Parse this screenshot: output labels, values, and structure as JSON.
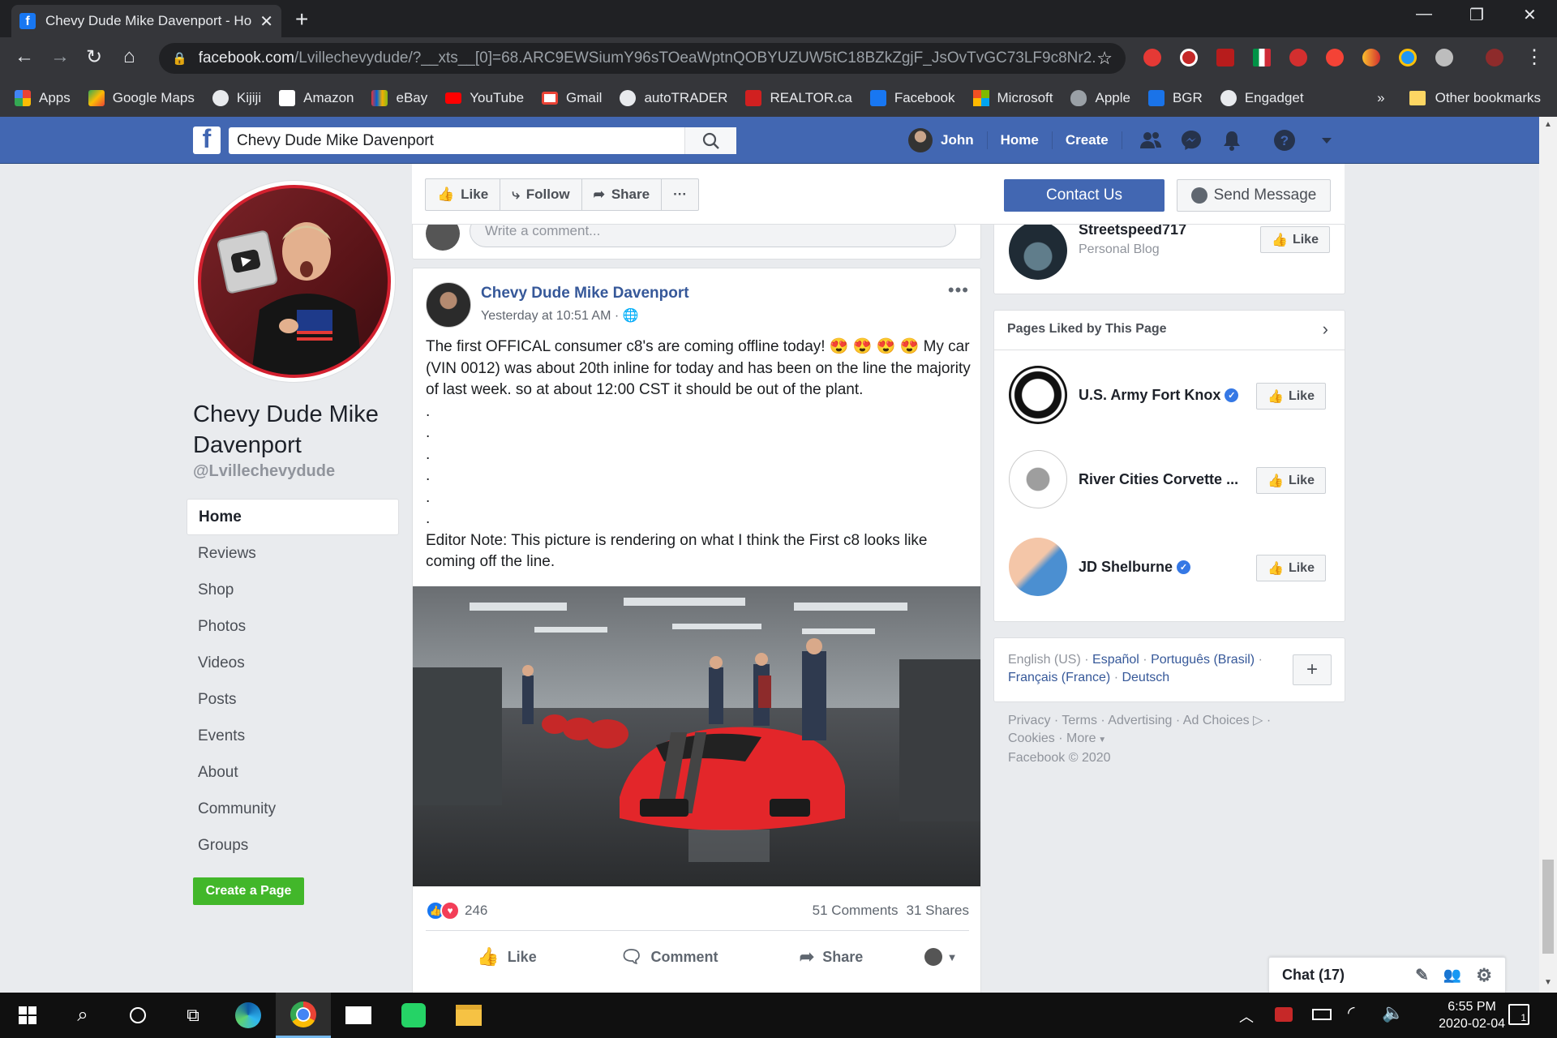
{
  "browser": {
    "tab_title": "Chevy Dude Mike Davenport - Ho",
    "url_host": "facebook.com",
    "url_path": "/Lvillechevydude/?__xts__[0]=68.ARC9EWSiumY96sTOeaWptnQOBYUZUW5tC18BZkZgjF_JsOvTvGC73LF9c8Nr2...",
    "bookmarks": [
      {
        "label": "Apps",
        "color": "#ea4335"
      },
      {
        "label": "Google Maps",
        "color": "#34a853"
      },
      {
        "label": "Kijiji",
        "color": "#9aa0a6"
      },
      {
        "label": "Amazon",
        "color": "#ffffff"
      },
      {
        "label": "eBay",
        "color": "#e53238"
      },
      {
        "label": "YouTube",
        "color": "#ff0000"
      },
      {
        "label": "Gmail",
        "color": "#ea4335"
      },
      {
        "label": "autoTRADER",
        "color": "#9aa0a6"
      },
      {
        "label": "REALTOR.ca",
        "color": "#d12020"
      },
      {
        "label": "Facebook",
        "color": "#1877f2"
      },
      {
        "label": "Microsoft",
        "color": "#f25022"
      },
      {
        "label": "Apple",
        "color": "#9aa0a6"
      },
      {
        "label": "BGR",
        "color": "#1a73e8"
      },
      {
        "label": "Engadget",
        "color": "#9aa0a6"
      }
    ],
    "overflow": "»",
    "other_bookmarks": "Other bookmarks"
  },
  "fb": {
    "search_value": "Chevy Dude Mike Davenport",
    "user": "John",
    "home": "Home",
    "create": "Create"
  },
  "page": {
    "name": "Chevy Dude Mike Davenport",
    "handle": "@Lvillechevydude",
    "nav": [
      "Home",
      "Reviews",
      "Shop",
      "Photos",
      "Videos",
      "Posts",
      "Events",
      "About",
      "Community",
      "Groups"
    ],
    "create_page": "Create a Page",
    "actions": {
      "like": "Like",
      "follow": "Follow",
      "share": "Share",
      "more": "···"
    },
    "contact": "Contact Us",
    "send_message": "Send Message"
  },
  "prev_post": {
    "comment_placeholder": "Write a comment..."
  },
  "post": {
    "author": "Chevy Dude Mike Davenport",
    "time": "Yesterday at 10:51 AM · ",
    "text_before": "The first OFFICAL consumer c8's are coming offline today! ",
    "emoji": "😍 😍 😍 😍",
    "text_after": " My car (VIN 0012) was about 20th inline for today and has been on the line the majority of last week. so at about 12:00 CST it should be out of the plant.\n.\n.\n.\n.\n.\n.\nEditor Note: This picture is rendering on what I think the First c8 looks like coming off the line.",
    "reactions": "246",
    "comments": "51 Comments",
    "shares": "31 Shares",
    "like": "Like",
    "comment": "Comment",
    "share": "Share"
  },
  "right": {
    "top_card": {
      "name": "Streetspeed717",
      "category": "Personal Blog",
      "like": "Like"
    },
    "liked_title": "Pages Liked by This Page",
    "liked": [
      {
        "name": "U.S. Army Fort Knox",
        "verified": "✓",
        "like": "Like"
      },
      {
        "name": "River Cities Corvette ...",
        "like": "Like"
      },
      {
        "name": "JD Shelburne",
        "verified": "✓",
        "like": "Like"
      }
    ],
    "languages": {
      "current": "English (US)",
      "others": [
        "Español",
        "Português (Brasil)",
        "Français (France)",
        "Deutsch"
      ],
      "add": "+"
    },
    "footer": {
      "links": [
        "Privacy",
        "Terms",
        "Advertising",
        "Ad Choices",
        "Cookies",
        "More"
      ],
      "copyright": "Facebook © 2020"
    }
  },
  "chat": {
    "label": "Chat (17)"
  },
  "taskbar": {
    "time": "6:55 PM",
    "date": "2020-02-04",
    "notif": "1"
  }
}
